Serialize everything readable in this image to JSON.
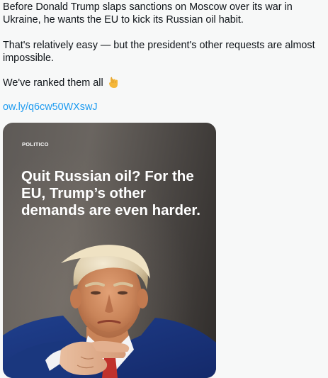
{
  "tweet": {
    "paragraph_1": "Before Donald Trump slaps sanctions on Moscow over its war in Ukraine, he wants the EU to kick its Russian oil habit.",
    "paragraph_2": "That's relatively easy — but the president's other requests are almost impossible.",
    "paragraph_3": "We've ranked them all",
    "emoji": "backhand-index-pointing-down",
    "link": "ow.ly/q6cw50WXswJ"
  },
  "media_card": {
    "publisher": "POLITICO",
    "headline": "Quit Russian oil? For the EU, Trump’s other demands are even harder."
  },
  "colors": {
    "link": "#1d9bf0",
    "text": "#0f1419",
    "background": "#f7f8f8"
  }
}
